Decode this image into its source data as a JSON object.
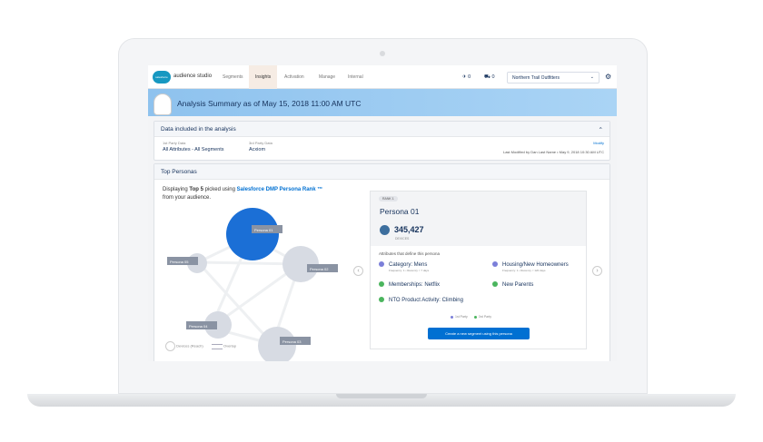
{
  "nav": {
    "brand": "audience studio",
    "logo": "salesforce",
    "tabs": [
      "Segments",
      "Insights",
      "Activation",
      "Manage",
      "Internal"
    ],
    "active_tab": "Insights",
    "pin_count": "0",
    "cart_count": "0",
    "org": "Northern Trail Outfitters"
  },
  "hero": {
    "title": "Analysis Summary as of May 15, 2018 11:00 AM UTC"
  },
  "data_section": {
    "title": "Data included in the analysis",
    "first_party_label": "1st Party Data",
    "first_party_value": "All Attributes - All Segments",
    "third_party_label": "3rd Party Data",
    "third_party_value": "Acxiom",
    "modify": "Modify",
    "last_modified": "Last Modified by Dan Last Name • May 9, 2018 10:30 AM UTC"
  },
  "personas": {
    "title": "Top Personas",
    "intro_pre": "Displaying ",
    "intro_bold": "Top 5",
    "intro_mid": " picked using ",
    "intro_link": "Salesforce DMP Persona Rank ™",
    "intro_post": "from your audience.",
    "nodes": [
      "Persona 01",
      "Persona 02",
      "Persona 03",
      "Persona 04",
      "Persona 05"
    ],
    "legend_devices": "Devices (Reach)",
    "legend_overlap": "Overlap"
  },
  "detail": {
    "rank": "RANK 1",
    "name": "Persona 01",
    "count": "345,427",
    "count_label": "DEVICES",
    "attr_title": "Attributes that define this persona",
    "attributes": [
      {
        "label": "Category: Mens",
        "sub": "Frequency: 1 • Recency < 7 days",
        "color": "#7b7fd9"
      },
      {
        "label": "Housing/New Homeowners",
        "sub": "Frequency: 1 • Recency < 120 days",
        "color": "#7b7fd9"
      },
      {
        "label": "Memberships: Netflix",
        "sub": "",
        "color": "#4bb55e"
      },
      {
        "label": "New Parents",
        "sub": "",
        "color": "#4bb55e"
      },
      {
        "label": "NTO Product Activity: Climbing",
        "sub": "",
        "color": "#4bb55e"
      }
    ],
    "legend_first": "1st Party",
    "legend_third": "3rd Party",
    "button": "Create a new segment using this persona"
  }
}
